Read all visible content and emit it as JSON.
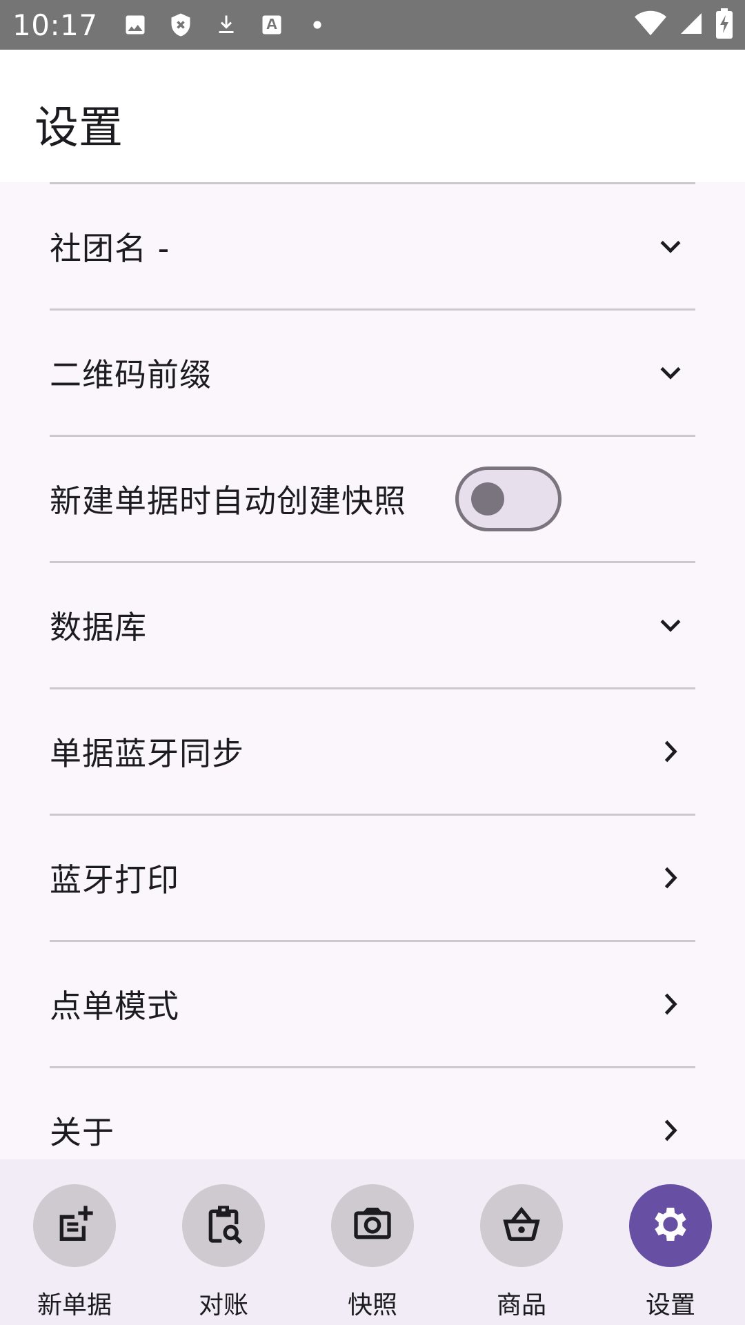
{
  "status": {
    "time": "10:17"
  },
  "appbar": {
    "title": "设置"
  },
  "settings": {
    "club_name": "社团名 -",
    "qr_prefix": "二维码前缀",
    "auto_snapshot": "新建单据时自动创建快照",
    "database": "数据库",
    "bt_sync": "单据蓝牙同步",
    "bt_print": "蓝牙打印",
    "order_mode": "点单模式",
    "about": "关于"
  },
  "nav": {
    "items": [
      {
        "label": "新单据",
        "icon": "note-add-icon"
      },
      {
        "label": "对账",
        "icon": "clipboard-search-icon"
      },
      {
        "label": "快照",
        "icon": "camera-icon"
      },
      {
        "label": "商品",
        "icon": "basket-icon"
      },
      {
        "label": "设置",
        "icon": "gear-icon",
        "active": true
      }
    ]
  },
  "colors": {
    "accent": "#6750A4",
    "statusbar": "#757575",
    "background": "#FBF6FC",
    "navbar": "#F1ECF5"
  }
}
